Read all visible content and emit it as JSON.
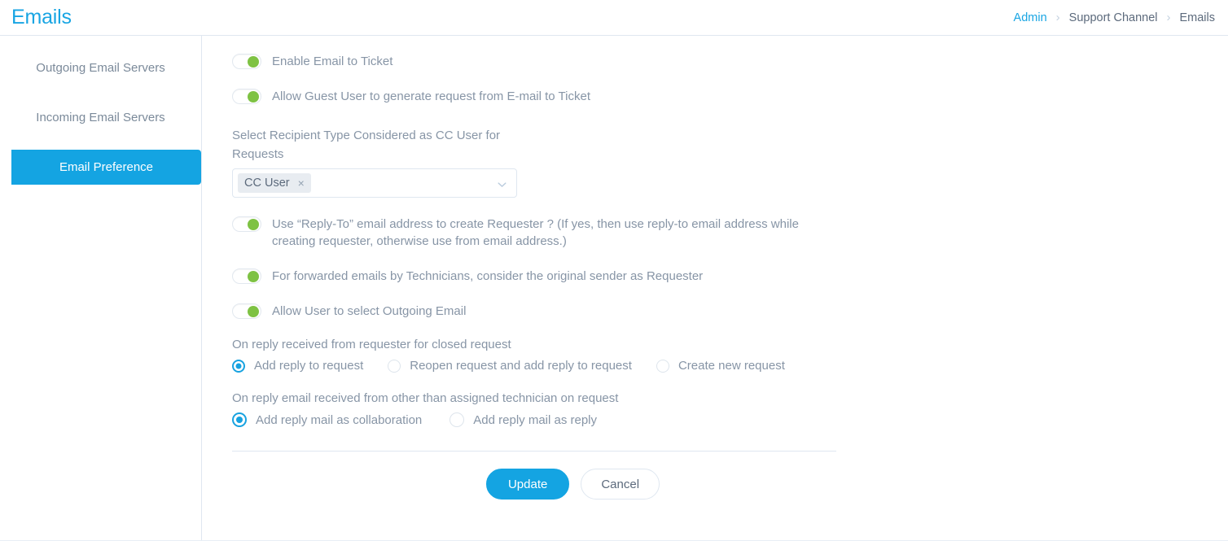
{
  "header": {
    "title": "Emails",
    "breadcrumb": [
      {
        "label": "Admin",
        "type": "link"
      },
      {
        "label": "Support Channel",
        "type": "text"
      },
      {
        "label": "Emails",
        "type": "current"
      }
    ],
    "separator": "›"
  },
  "sidebar": {
    "items": [
      {
        "label": "Outgoing Email Servers",
        "active": false
      },
      {
        "label": "Incoming Email Servers",
        "active": false
      },
      {
        "label": "Email Preference",
        "active": true
      }
    ]
  },
  "main": {
    "toggles": [
      {
        "label": "Enable Email to Ticket",
        "on": true
      },
      {
        "label": "Allow Guest User to generate request from E-mail to Ticket",
        "on": true
      }
    ],
    "recipient_field": {
      "label": "Select Recipient Type Considered as CC User for Requests",
      "chip": "CC User",
      "chip_remove": "×"
    },
    "toggles2": [
      {
        "label": "Use “Reply-To” email address to create Requester ? (If yes, then use reply-to email address while creating requester, otherwise use from email address.)",
        "on": true
      },
      {
        "label": "For forwarded emails by Technicians, consider the original sender as Requester",
        "on": true
      },
      {
        "label": "Allow User to select Outgoing Email",
        "on": true
      }
    ],
    "radio_group_1": {
      "title": "On reply received from requester for closed request",
      "options": [
        {
          "label": "Add reply to request",
          "checked": true
        },
        {
          "label": "Reopen request and add reply to request",
          "checked": false
        },
        {
          "label": "Create new request",
          "checked": false
        }
      ]
    },
    "radio_group_2": {
      "title": "On reply email received from other than assigned technician on request",
      "options": [
        {
          "label": "Add reply mail as collaboration",
          "checked": true
        },
        {
          "label": "Add reply mail as reply",
          "checked": false
        }
      ]
    },
    "actions": {
      "update_label": "Update",
      "cancel_label": "Cancel"
    }
  },
  "colors": {
    "accent_blue": "#14a4e2",
    "toggle_green": "#7ec243",
    "radio_blue": "#17a2e0",
    "text_gray": "#8795a6",
    "border": "#dfe7f0"
  }
}
